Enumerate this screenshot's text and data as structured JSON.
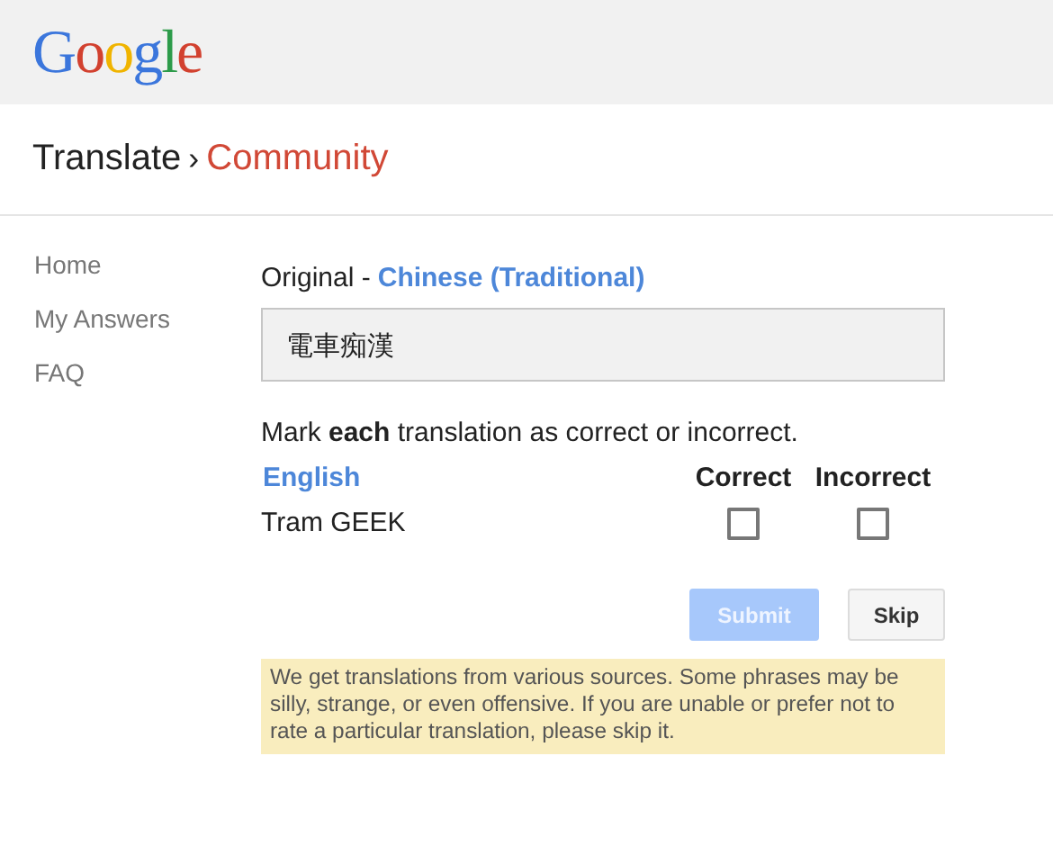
{
  "logo": {
    "text": "Google"
  },
  "breadcrumb": {
    "parent": "Translate",
    "separator": "›",
    "current": "Community"
  },
  "sidebar": {
    "items": [
      {
        "label": "Home"
      },
      {
        "label": "My Answers"
      },
      {
        "label": "FAQ"
      }
    ]
  },
  "original": {
    "label": "Original -",
    "language": "Chinese (Traditional)",
    "text": "電車痴漢"
  },
  "instruction": "Mark **each** translation as correct or incorrect.",
  "table": {
    "columns": [
      "English",
      "Correct",
      "Incorrect"
    ],
    "rows": [
      {
        "text": "Tram GEEK",
        "correct": false,
        "incorrect": false
      }
    ]
  },
  "buttons": [
    {
      "label": "Submit",
      "kind": "primary",
      "disabled": true
    },
    {
      "label": "Skip",
      "kind": "secondary",
      "disabled": false
    }
  ],
  "notice": "We get translations from various sources. Some phrases may be silly, strange, or even offensive. If you are unable or prefer not to rate a particular translation, please skip it."
}
